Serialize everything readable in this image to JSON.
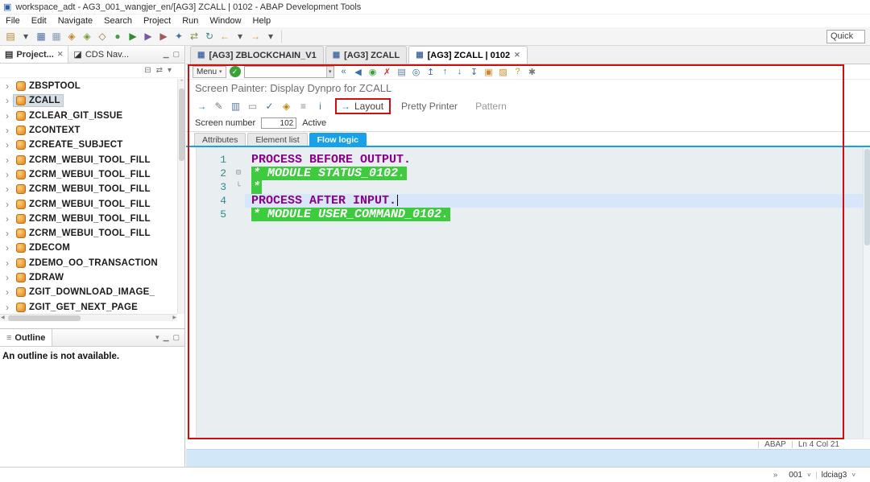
{
  "glyphs": {
    "app": "▣",
    "dropdown": "▾",
    "close": "✕",
    "expand": "›",
    "divider": "|",
    "chevron_up": "⌃",
    "scroll_left": "◀",
    "scroll_right": "▶",
    "check": "✓",
    "caret_down": "˅",
    "menu_icon": "≡"
  },
  "titlebar": {
    "title": "workspace_adt - AG3_001_wangjer_en/[AG3] ZCALL | 0102 - ABAP Development Tools"
  },
  "menubar": {
    "items": [
      "File",
      "Edit",
      "Navigate",
      "Search",
      "Project",
      "Run",
      "Window",
      "Help"
    ]
  },
  "main_toolbar": {
    "quick_access": "Quick",
    "icons": [
      {
        "name": "new-wizard-icon",
        "glyph": "▤",
        "color": "#b8862b"
      },
      {
        "name": "new-dropdown-icon",
        "glyph": "▾",
        "color": "#555555"
      },
      {
        "name": "save-icon",
        "glyph": "▦",
        "color": "#4a6fa5"
      },
      {
        "name": "save-all-icon",
        "glyph": "▦",
        "color": "#8a9ab5"
      },
      {
        "name": "activate-icon",
        "glyph": "◈",
        "color": "#c08820"
      },
      {
        "name": "mass-activate-icon",
        "glyph": "◈",
        "color": "#7a9a3a"
      },
      {
        "name": "inactive-objects-icon",
        "glyph": "◇",
        "color": "#a06a3a"
      },
      {
        "name": "debug-icon",
        "glyph": "●",
        "color": "#4a9a4a"
      },
      {
        "name": "run-icon",
        "glyph": "▶",
        "color": "#2e8b2e"
      },
      {
        "name": "profile-icon",
        "glyph": "▶",
        "color": "#7a5aa0"
      },
      {
        "name": "coverage-icon",
        "glyph": "▶",
        "color": "#a05a5a"
      },
      {
        "name": "new-abap-object-icon",
        "glyph": "✦",
        "color": "#4a6fa5"
      },
      {
        "name": "link-with-editor-icon",
        "glyph": "⇄",
        "color": "#8a8a3a"
      },
      {
        "name": "refresh-icon",
        "glyph": "↻",
        "color": "#3a8a8a"
      },
      {
        "name": "back-icon",
        "glyph": "←",
        "color": "#c8a030"
      },
      {
        "name": "back-dropdown-icon",
        "glyph": "▾",
        "color": "#555555"
      },
      {
        "name": "forward-icon",
        "glyph": "→",
        "color": "#c8a030"
      },
      {
        "name": "forward-dropdown-icon",
        "glyph": "▾",
        "color": "#555555"
      }
    ]
  },
  "sidebar": {
    "tabs": [
      {
        "name": "tab-project-explorer",
        "label": "Project...",
        "icon": "▤",
        "active": true
      },
      {
        "name": "tab-cds-navigator",
        "label": "CDS Nav...",
        "icon": "◪",
        "active": false
      }
    ],
    "window_icons": [
      {
        "name": "minimize-icon",
        "glyph": "▁",
        "color": "#777777"
      },
      {
        "name": "maximize-icon",
        "glyph": "▢",
        "color": "#777777"
      }
    ],
    "toolbar_icons": [
      {
        "name": "collapse-all-icon",
        "glyph": "⊟",
        "color": "#777777"
      },
      {
        "name": "link-with-editor-icon",
        "glyph": "⇄",
        "color": "#777777"
      },
      {
        "name": "view-menu-icon",
        "glyph": "▾",
        "color": "#777777"
      }
    ],
    "tree": [
      {
        "label": "ZBSPTOOL"
      },
      {
        "label": "ZCALL",
        "selected": true
      },
      {
        "label": "ZCLEAR_GIT_ISSUE"
      },
      {
        "label": "ZCONTEXT"
      },
      {
        "label": "ZCREATE_SUBJECT"
      },
      {
        "label": "ZCRM_WEBUI_TOOL_FILL"
      },
      {
        "label": "ZCRM_WEBUI_TOOL_FILL"
      },
      {
        "label": "ZCRM_WEBUI_TOOL_FILL"
      },
      {
        "label": "ZCRM_WEBUI_TOOL_FILL"
      },
      {
        "label": "ZCRM_WEBUI_TOOL_FILL"
      },
      {
        "label": "ZCRM_WEBUI_TOOL_FILL"
      },
      {
        "label": "ZDECOM"
      },
      {
        "label": "ZDEMO_OO_TRANSACTION"
      },
      {
        "label": "ZDRAW"
      },
      {
        "label": "ZGIT_DOWNLOAD_IMAGE_"
      },
      {
        "label": "ZGIT_GET_NEXT_PAGE"
      }
    ]
  },
  "outline": {
    "title": "Outline",
    "message": "An outline is not available.",
    "window_icons": [
      {
        "name": "view-menu-icon",
        "glyph": "▾",
        "color": "#777777"
      },
      {
        "name": "minimize-icon",
        "glyph": "▁",
        "color": "#777777"
      },
      {
        "name": "maximize-icon",
        "glyph": "▢",
        "color": "#777777"
      }
    ]
  },
  "editor": {
    "tabs": [
      {
        "label": "[AG3] ZBLOCKCHAIN_V1",
        "icon": "▦",
        "active": false
      },
      {
        "label": "[AG3] ZCALL",
        "icon": "▦",
        "active": false
      },
      {
        "label": "[AG3] ZCALL | 0102",
        "icon": "▦",
        "active": true
      }
    ],
    "gui": {
      "menu_label": "Menu",
      "toolbar_icons": [
        {
          "name": "collapse-icon",
          "glyph": "«",
          "color": "#3b6ea5"
        },
        {
          "name": "back-icon",
          "glyph": "◀",
          "color": "#3b6ea5"
        },
        {
          "name": "exit-icon",
          "glyph": "◉",
          "color": "#3aa13a"
        },
        {
          "name": "cancel-icon",
          "glyph": "✗",
          "color": "#c43a3a"
        },
        {
          "name": "print-icon",
          "glyph": "▤",
          "color": "#5a7a9a"
        },
        {
          "name": "find-icon",
          "glyph": "◎",
          "color": "#3b6ea5"
        },
        {
          "name": "first-page-icon",
          "glyph": "↥",
          "color": "#3b6ea5"
        },
        {
          "name": "previous-page-icon",
          "glyph": "↑",
          "color": "#3b6ea5"
        },
        {
          "name": "next-page-icon",
          "glyph": "↓",
          "color": "#3b6ea5"
        },
        {
          "name": "last-page-icon",
          "glyph": "↧",
          "color": "#3b6ea5"
        },
        {
          "name": "new-session-icon",
          "glyph": "▣",
          "color": "#d08a2e"
        },
        {
          "name": "create-shortcut-icon",
          "glyph": "▨",
          "color": "#d08a2e"
        },
        {
          "name": "help-icon",
          "glyph": "?",
          "color": "#c8a020"
        },
        {
          "name": "customize-icon",
          "glyph": "✱",
          "color": "#7a7a7a"
        }
      ],
      "heading": "Screen Painter: Display Dynpro for ZCALL",
      "painter_icons": [
        {
          "name": "other-object-icon",
          "glyph": "→",
          "color": "#2a7de1"
        },
        {
          "name": "display-modify-icon",
          "glyph": "✎",
          "color": "#777777"
        },
        {
          "name": "copy-icon",
          "glyph": "▥",
          "color": "#5a7a9a"
        },
        {
          "name": "delete-icon",
          "glyph": "▭",
          "color": "#888888"
        },
        {
          "name": "check-icon",
          "glyph": "✓",
          "color": "#3b6ea5"
        },
        {
          "name": "where-used-icon",
          "glyph": "◈",
          "color": "#b8860b"
        },
        {
          "name": "sort-icon",
          "glyph": "≡",
          "color": "#888888"
        },
        {
          "name": "info-icon",
          "glyph": "i",
          "color": "#2a7de1"
        }
      ],
      "layout_button": {
        "icon": "→",
        "label": "Layout"
      },
      "pretty_printer_label": "Pretty Printer",
      "pattern_label": "Pattern",
      "screen_number_label": "Screen number",
      "screen_number_value": "102",
      "active_label": "Active",
      "view_tabs": [
        {
          "name": "tab-attributes",
          "label": "Attributes",
          "active": false
        },
        {
          "name": "tab-element-list",
          "label": "Element list",
          "active": false
        },
        {
          "name": "tab-flow-logic",
          "label": "Flow logic",
          "active": true
        }
      ]
    },
    "code": [
      {
        "num": "1",
        "fold": "",
        "text": "PROCESS BEFORE OUTPUT.",
        "type": "keyword"
      },
      {
        "num": "2",
        "fold": "⊟",
        "text": "* MODULE STATUS_0102.",
        "type": "comment"
      },
      {
        "num": "3",
        "fold": "└",
        "text": "*",
        "type": "comment"
      },
      {
        "num": "4",
        "fold": "",
        "text": "PROCESS AFTER INPUT.",
        "type": "keyword",
        "current": true
      },
      {
        "num": "5",
        "fold": "",
        "text": "* MODULE USER_COMMAND_0102.",
        "type": "comment"
      }
    ],
    "status": {
      "language": "ABAP",
      "position": "Ln 4 Col 21"
    }
  },
  "statusbar": {
    "chevron": "»",
    "system": "001",
    "server": "ldciag3"
  }
}
